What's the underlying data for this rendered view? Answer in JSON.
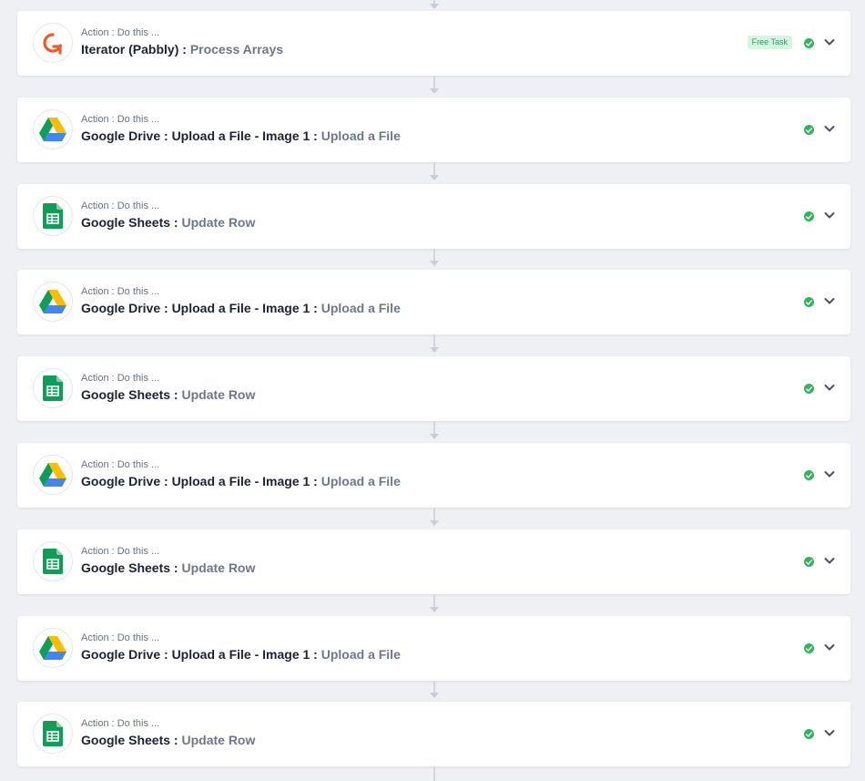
{
  "steps": [
    {
      "app": "iterator",
      "label": "Action : Do this ...",
      "app_name": "Iterator (Pabbly)",
      "separator": " : ",
      "action": "Process Arrays",
      "badge": "Free Task"
    },
    {
      "app": "google-drive",
      "label": "Action : Do this ...",
      "app_name": "Google Drive : Upload a File - Image 1",
      "separator": " : ",
      "action": "Upload a File"
    },
    {
      "app": "google-sheets",
      "label": "Action : Do this ...",
      "app_name": "Google Sheets",
      "separator": " : ",
      "action": "Update Row"
    },
    {
      "app": "google-drive",
      "label": "Action : Do this ...",
      "app_name": "Google Drive : Upload a File - Image 1",
      "separator": " : ",
      "action": "Upload a File"
    },
    {
      "app": "google-sheets",
      "label": "Action : Do this ...",
      "app_name": "Google Sheets",
      "separator": " : ",
      "action": "Update Row"
    },
    {
      "app": "google-drive",
      "label": "Action : Do this ...",
      "app_name": "Google Drive : Upload a File - Image 1",
      "separator": " : ",
      "action": "Upload a File"
    },
    {
      "app": "google-sheets",
      "label": "Action : Do this ...",
      "app_name": "Google Sheets",
      "separator": " : ",
      "action": "Update Row"
    },
    {
      "app": "google-drive",
      "label": "Action : Do this ...",
      "app_name": "Google Drive : Upload a File - Image 1",
      "separator": " : ",
      "action": "Upload a File"
    },
    {
      "app": "google-sheets",
      "label": "Action : Do this ...",
      "app_name": "Google Sheets",
      "separator": " : ",
      "action": "Update Row"
    }
  ],
  "icons": {
    "status": "check-circle-icon",
    "toggle": "chevron-down-icon"
  },
  "colors": {
    "page_bg": "#eef0f4",
    "card_bg": "#ffffff",
    "status_green": "#33b35a",
    "badge_bg": "#d7f5e4",
    "badge_text": "#2f9a5b",
    "iterator_orange": "#f0592a"
  }
}
